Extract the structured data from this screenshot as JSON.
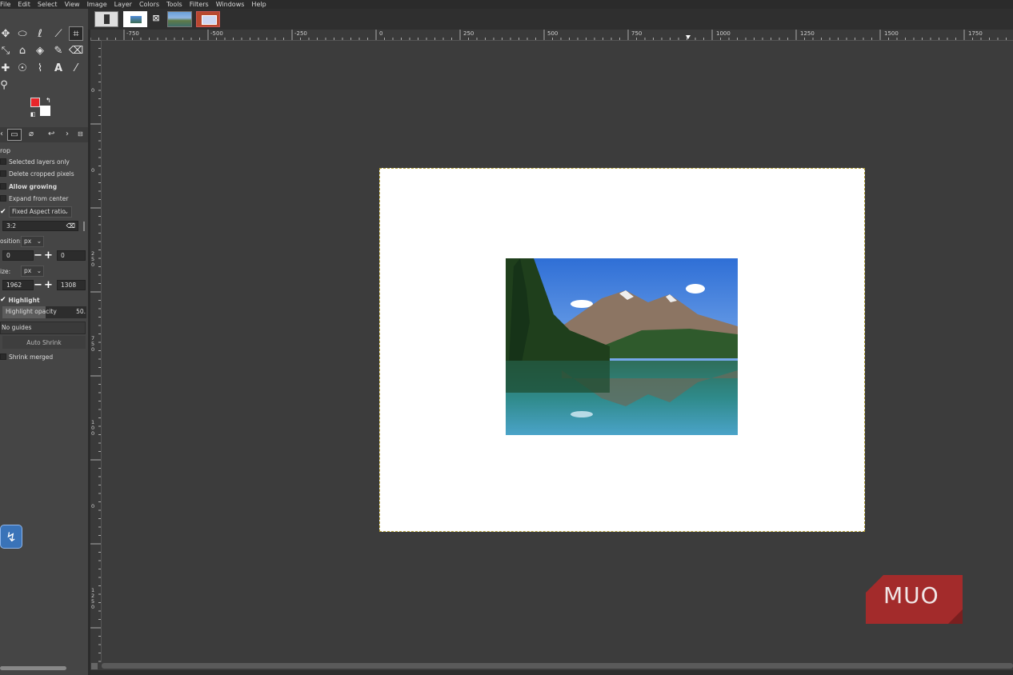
{
  "menu": [
    "File",
    "Edit",
    "Select",
    "View",
    "Image",
    "Layer",
    "Colors",
    "Tools",
    "Filters",
    "Windows",
    "Help"
  ],
  "ruler": {
    "h_labels": [
      "-750",
      "-500",
      "-250",
      "0",
      "250",
      "500",
      "750",
      "1000",
      "1250",
      "1500",
      "1750"
    ],
    "v_labels": [
      "0",
      "0",
      "2",
      "5",
      "0",
      "7",
      "5",
      "0",
      "1",
      "0",
      "0",
      "0",
      "1",
      "2",
      "5",
      "0"
    ]
  },
  "colors": {
    "foreground": "#e8262a",
    "background": "#ffffff"
  },
  "tool_options": {
    "title": "rop",
    "selected_layers_only": "Selected layers only",
    "delete_cropped_pixels": "Delete cropped pixels",
    "allow_growing": "Allow growing",
    "expand_from_center": "Expand from center",
    "fixed_label": "Fixed Aspect ratio",
    "ratio_value": "3:2",
    "position_label": "osition:",
    "position_unit": "px",
    "pos_x": "0",
    "pos_y": "0",
    "size_label": "ize:",
    "size_unit": "px",
    "size_w": "1962",
    "size_h": "1308",
    "highlight": "Highlight",
    "highlight_opacity_label": "Highlight opacity",
    "highlight_opacity_value": "50.",
    "guides": "No guides",
    "auto_shrink": "Auto Shrink",
    "shrink_merged": "Shrink merged"
  },
  "logo_text": "MUO"
}
